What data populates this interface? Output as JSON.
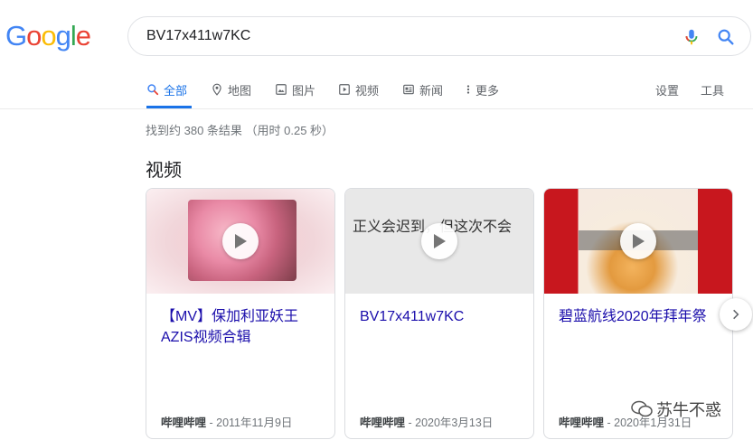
{
  "logo": {
    "letters": [
      "G",
      "o",
      "o",
      "g",
      "l",
      "e"
    ],
    "colors": [
      "#4285f4",
      "#ea4335",
      "#fbbc05",
      "#4285f4",
      "#34a853",
      "#ea4335"
    ]
  },
  "search": {
    "query": "BV17x411w7KC"
  },
  "tabs": [
    {
      "label": "全部",
      "icon": "search-icon",
      "active": true
    },
    {
      "label": "地图",
      "icon": "map-pin-icon"
    },
    {
      "label": "图片",
      "icon": "image-icon"
    },
    {
      "label": "视频",
      "icon": "video-icon"
    },
    {
      "label": "新闻",
      "icon": "news-icon"
    },
    {
      "label": "更多",
      "icon": "more-vert-icon"
    }
  ],
  "tools": {
    "settings": "设置",
    "tools": "工具"
  },
  "result_stats": "找到约 380 条结果 （用时 0.25 秒）",
  "videos": {
    "title": "视频",
    "cards": [
      {
        "title": "【MV】保加利亚妖王AZIS视频合辑",
        "source": "哔哩哔哩",
        "date": " - 2011年11月9日"
      },
      {
        "title": "BV17x411w7KC",
        "source": "哔哩哔哩",
        "date": " - 2020年3月13日",
        "thumb_text": "正义会迟到，但这次不会"
      },
      {
        "title": "碧蓝航线2020年拜年祭",
        "source": "哔哩哔哩",
        "date": " - 2020年1月31日"
      }
    ]
  },
  "watermark": "苏牛不惑"
}
